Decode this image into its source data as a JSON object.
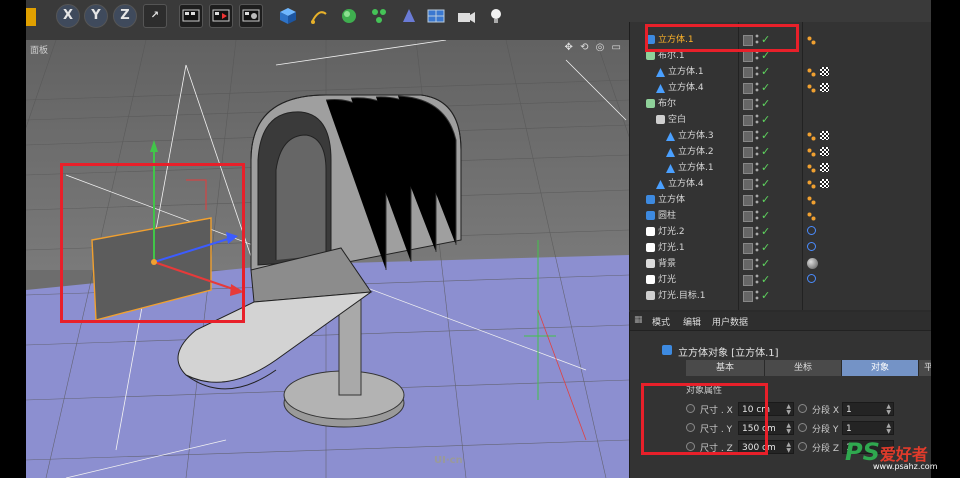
{
  "toolbar": {
    "axis_x": "X",
    "axis_y": "Y",
    "axis_z": "Z"
  },
  "viewport": {
    "panel_label": "面板",
    "nav_icons": "✥ ⟲ ◎ ▭",
    "watermark": "UI·cn"
  },
  "object_manager": {
    "items": [
      {
        "label": "立方体.1",
        "indent": 0,
        "selected": true,
        "type": "cube",
        "tags": [
          "orange"
        ]
      },
      {
        "label": "布尔.1",
        "indent": 0,
        "selected": false,
        "type": "boole",
        "tags": []
      },
      {
        "label": "立方体.1",
        "indent": 1,
        "selected": false,
        "type": "poly",
        "tags": [
          "orange",
          "checker"
        ]
      },
      {
        "label": "立方体.4",
        "indent": 1,
        "selected": false,
        "type": "poly",
        "tags": [
          "orange",
          "checker"
        ]
      },
      {
        "label": "布尔",
        "indent": 0,
        "selected": false,
        "type": "boole",
        "tags": []
      },
      {
        "label": "空白",
        "indent": 1,
        "selected": false,
        "type": "null",
        "tags": []
      },
      {
        "label": "立方体.3",
        "indent": 2,
        "selected": false,
        "type": "poly",
        "tags": [
          "orange",
          "checker"
        ]
      },
      {
        "label": "立方体.2",
        "indent": 2,
        "selected": false,
        "type": "poly",
        "tags": [
          "orange",
          "checker"
        ]
      },
      {
        "label": "立方体.1",
        "indent": 2,
        "selected": false,
        "type": "poly",
        "tags": [
          "orange",
          "checker"
        ]
      },
      {
        "label": "立方体.4",
        "indent": 1,
        "selected": false,
        "type": "poly",
        "tags": [
          "orange",
          "checker"
        ]
      },
      {
        "label": "立方体",
        "indent": 0,
        "selected": false,
        "type": "cube",
        "tags": [
          "orange"
        ]
      },
      {
        "label": "圆柱",
        "indent": 0,
        "selected": false,
        "type": "cylinder",
        "tags": [
          "orange"
        ]
      },
      {
        "label": "灯光.2",
        "indent": 0,
        "selected": false,
        "type": "light",
        "tags": [
          "target"
        ]
      },
      {
        "label": "灯光.1",
        "indent": 0,
        "selected": false,
        "type": "light",
        "tags": [
          "target"
        ]
      },
      {
        "label": "背景",
        "indent": 0,
        "selected": false,
        "type": "bg",
        "tags": [
          "sphere"
        ]
      },
      {
        "label": "灯光",
        "indent": 0,
        "selected": false,
        "type": "light",
        "tags": [
          "target"
        ]
      },
      {
        "label": "灯光.目标.1",
        "indent": 0,
        "selected": false,
        "type": "null",
        "tags": []
      }
    ]
  },
  "attribute_manager": {
    "menu": {
      "mode": "模式",
      "edit": "编辑",
      "userdata": "用户数据"
    },
    "title": "立方体对象 [立方体.1]",
    "tabs": {
      "basic": "基本",
      "coord": "坐标",
      "object": "对象",
      "smooth": "平滑着色"
    },
    "section": "对象属性",
    "size_x_label": "尺寸 . X",
    "size_y_label": "尺寸 . Y",
    "size_z_label": "尺寸 . Z",
    "size_x": "10 cm",
    "size_y": "150 cm",
    "size_z": "300 cm",
    "seg_x_label": "分段 X",
    "seg_y_label": "分段 Y",
    "seg_z_label": "分段 Z",
    "seg_x": "1",
    "seg_y": "1",
    "seg_z": "1"
  },
  "brand": {
    "ps": "PS",
    "name": "爱好者",
    "url": "www.psahz.com"
  },
  "colors": {
    "highlight": "#e8202a",
    "selected_text": "#ffb42a",
    "active_tab": "#7493c6",
    "viewport_floor": "#8c8fd0"
  }
}
